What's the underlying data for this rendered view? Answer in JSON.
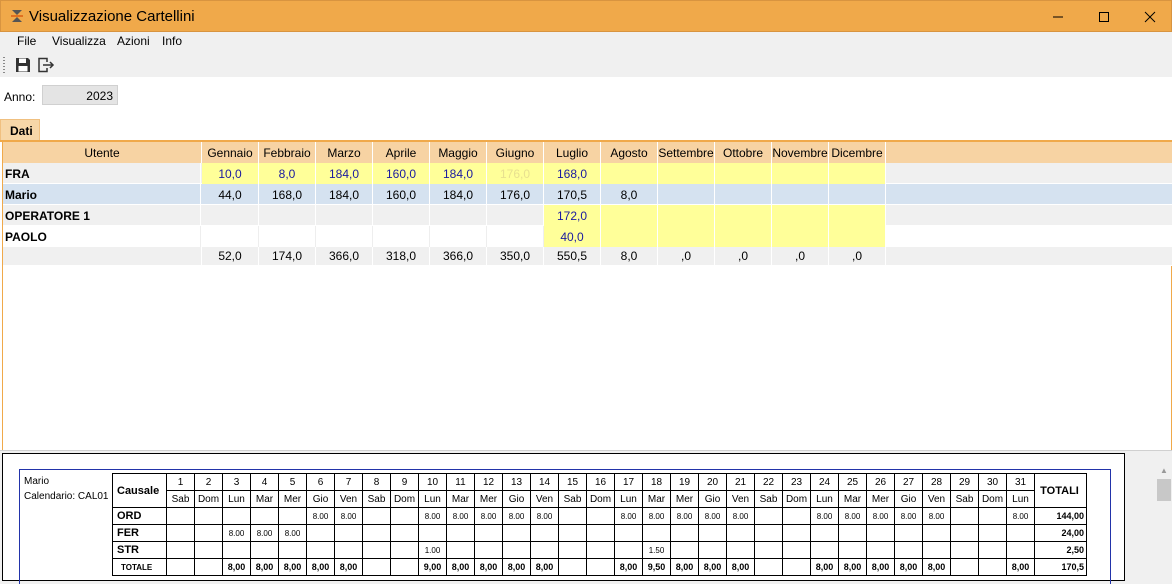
{
  "window": {
    "title": "Visualizzazione Cartellini"
  },
  "menu": [
    "File",
    "Visualizza",
    "Azioni",
    "Info"
  ],
  "anno": {
    "label": "Anno:",
    "value": "2023"
  },
  "tab": "Dati",
  "grid": {
    "headers": [
      "Utente",
      "Gennaio",
      "Febbraio",
      "Marzo",
      "Aprile",
      "Maggio",
      "Giugno",
      "Luglio",
      "Agosto",
      "Settembre",
      "Ottobre",
      "Novembre",
      "Dicembre"
    ],
    "rows": [
      {
        "name": "FRA",
        "values": [
          "10,0",
          "8,0",
          "184,0",
          "160,0",
          "184,0",
          "176,0",
          "168,0",
          "",
          "",
          "",
          "",
          ""
        ]
      },
      {
        "name": "Mario",
        "values": [
          "44,0",
          "168,0",
          "184,0",
          "160,0",
          "184,0",
          "176,0",
          "170,5",
          "8,0",
          "",
          "",
          "",
          ""
        ]
      },
      {
        "name": "OPERATORE 1",
        "values": [
          "",
          "",
          "",
          "",
          "",
          "",
          "172,0",
          "",
          "",
          "",
          "",
          ""
        ]
      },
      {
        "name": "PAOLO",
        "values": [
          "",
          "",
          "",
          "",
          "",
          "",
          "40,0",
          "",
          "",
          "",
          "",
          ""
        ]
      }
    ],
    "totals": [
      "52,0",
      "174,0",
      "366,0",
      "318,0",
      "366,0",
      "350,0",
      "550,5",
      "8,0",
      ",0",
      ",0",
      ",0",
      ",0"
    ]
  },
  "report": {
    "user": "Mario",
    "calendar": "Calendario: CAL01",
    "causale_label": "Causale",
    "totali_label": "TOTALI",
    "days": [
      "1",
      "2",
      "3",
      "4",
      "5",
      "6",
      "7",
      "8",
      "9",
      "10",
      "11",
      "12",
      "13",
      "14",
      "15",
      "16",
      "17",
      "18",
      "19",
      "20",
      "21",
      "22",
      "23",
      "24",
      "25",
      "26",
      "27",
      "28",
      "29",
      "30",
      "31"
    ],
    "weekdays": [
      "Sab",
      "Dom",
      "Lun",
      "Mar",
      "Mer",
      "Gio",
      "Ven",
      "Sab",
      "Dom",
      "Lun",
      "Mar",
      "Mer",
      "Gio",
      "Ven",
      "Sab",
      "Dom",
      "Lun",
      "Mar",
      "Mer",
      "Gio",
      "Ven",
      "Sab",
      "Dom",
      "Lun",
      "Mar",
      "Mer",
      "Gio",
      "Ven",
      "Sab",
      "Dom",
      "Lun"
    ],
    "rows": [
      {
        "label": "ORD",
        "values": [
          "",
          "",
          "",
          "",
          "",
          "8.00",
          "8.00",
          "",
          "",
          "8.00",
          "8.00",
          "8.00",
          "8.00",
          "8.00",
          "",
          "",
          "8.00",
          "8.00",
          "8.00",
          "8.00",
          "8.00",
          "",
          "",
          "8.00",
          "8.00",
          "8.00",
          "8.00",
          "8.00",
          "",
          "",
          "8.00"
        ],
        "total": "144,00"
      },
      {
        "label": "FER",
        "values": [
          "",
          "",
          "8.00",
          "8.00",
          "8.00",
          "",
          "",
          "",
          "",
          "",
          "",
          "",
          "",
          "",
          "",
          "",
          "",
          "",
          "",
          "",
          "",
          "",
          "",
          "",
          "",
          "",
          "",
          "",
          "",
          "",
          ""
        ],
        "total": "24,00"
      },
      {
        "label": "STR",
        "values": [
          "",
          "",
          "",
          "",
          "",
          "",
          "",
          "",
          "",
          "1.00",
          "",
          "",
          "",
          "",
          "",
          "",
          "",
          "1.50",
          "",
          "",
          "",
          "",
          "",
          "",
          "",
          "",
          "",
          "",
          "",
          "",
          ""
        ],
        "total": "2,50"
      },
      {
        "label": "TOTALE",
        "values": [
          "",
          "",
          "8,00",
          "8,00",
          "8,00",
          "8,00",
          "8,00",
          "",
          "",
          "9,00",
          "8,00",
          "8,00",
          "8,00",
          "8,00",
          "",
          "",
          "8,00",
          "9,50",
          "8,00",
          "8,00",
          "8,00",
          "",
          "",
          "8,00",
          "8,00",
          "8,00",
          "8,00",
          "8,00",
          "",
          "",
          "8,00"
        ],
        "total": "170,5"
      }
    ]
  }
}
